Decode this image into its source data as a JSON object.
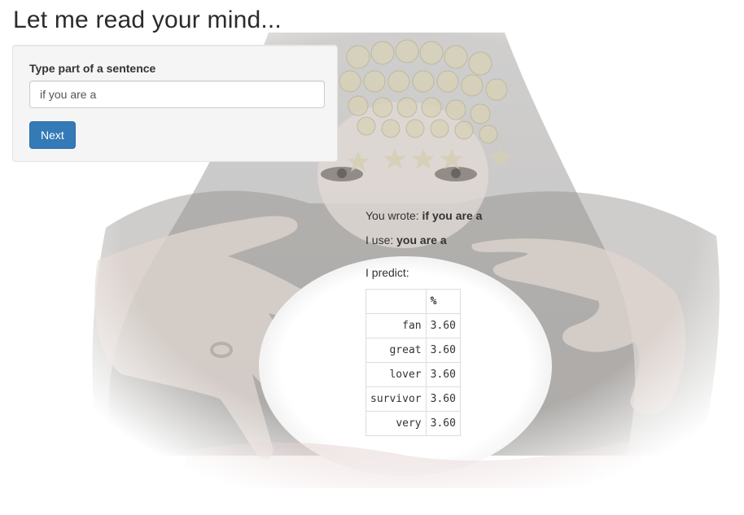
{
  "page": {
    "title": "Let me read your mind..."
  },
  "sidebar": {
    "input_label": "Type part of a sentence",
    "input_value": "if you are a",
    "next_button_label": "Next"
  },
  "output": {
    "you_wrote_label": "You wrote:",
    "you_wrote_value": "if you are a",
    "i_use_label": "I use:",
    "i_use_value": "you are a",
    "predict_label": "I predict:",
    "table": {
      "columns": [
        "",
        "%"
      ],
      "rows": [
        {
          "word": "fan",
          "pct": "3.60"
        },
        {
          "word": "great",
          "pct": "3.60"
        },
        {
          "word": "lover",
          "pct": "3.60"
        },
        {
          "word": "survivor",
          "pct": "3.60"
        },
        {
          "word": "very",
          "pct": "3.60"
        }
      ]
    }
  },
  "colors": {
    "button_primary": "#337ab7",
    "well_background": "#f5f5f5"
  },
  "icons": {
    "background": "fortune-teller-crystal-ball-image"
  }
}
